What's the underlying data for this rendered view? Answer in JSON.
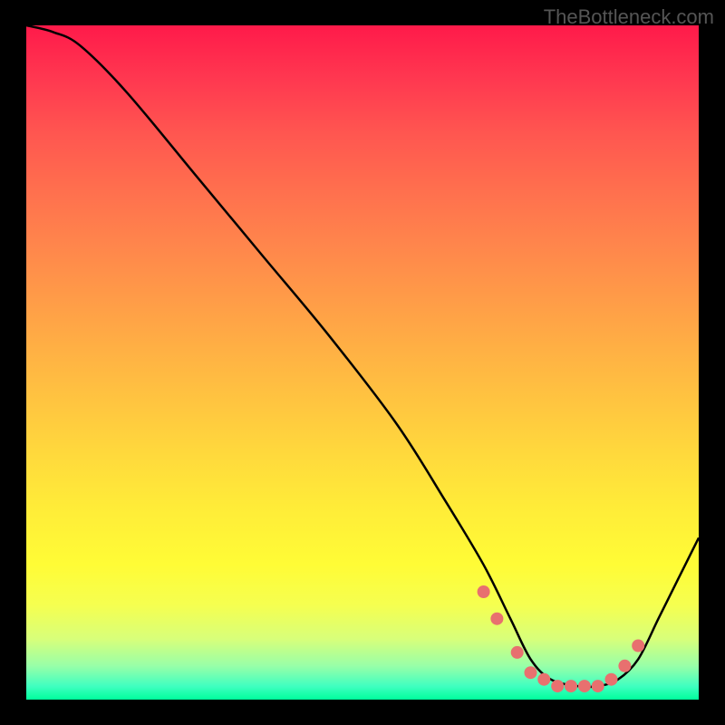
{
  "watermark": "TheBottleneck.com",
  "chart_data": {
    "type": "line",
    "title": "",
    "xlabel": "",
    "ylabel": "",
    "xlim": [
      0,
      100
    ],
    "ylim": [
      0,
      100
    ],
    "background_gradient": {
      "top": "#ff1a4a",
      "bottom": "#00ff9c",
      "description": "vertical red-to-green gradient indicating bottleneck severity"
    },
    "series": [
      {
        "name": "bottleneck-curve",
        "color": "#000000",
        "x": [
          0,
          4,
          8,
          15,
          25,
          35,
          45,
          55,
          62,
          68,
          72,
          75,
          78,
          82,
          85,
          88,
          91,
          94,
          97,
          100
        ],
        "y": [
          100,
          99,
          97,
          90,
          78,
          66,
          54,
          41,
          30,
          20,
          12,
          6,
          3,
          2,
          2,
          3,
          6,
          12,
          18,
          24
        ]
      },
      {
        "name": "highlight-points",
        "color": "#e8706f",
        "type": "scatter",
        "x": [
          68,
          70,
          73,
          75,
          77,
          79,
          81,
          83,
          85,
          87,
          89,
          91
        ],
        "y": [
          16,
          12,
          7,
          4,
          3,
          2,
          2,
          2,
          2,
          3,
          5,
          8
        ]
      }
    ]
  }
}
